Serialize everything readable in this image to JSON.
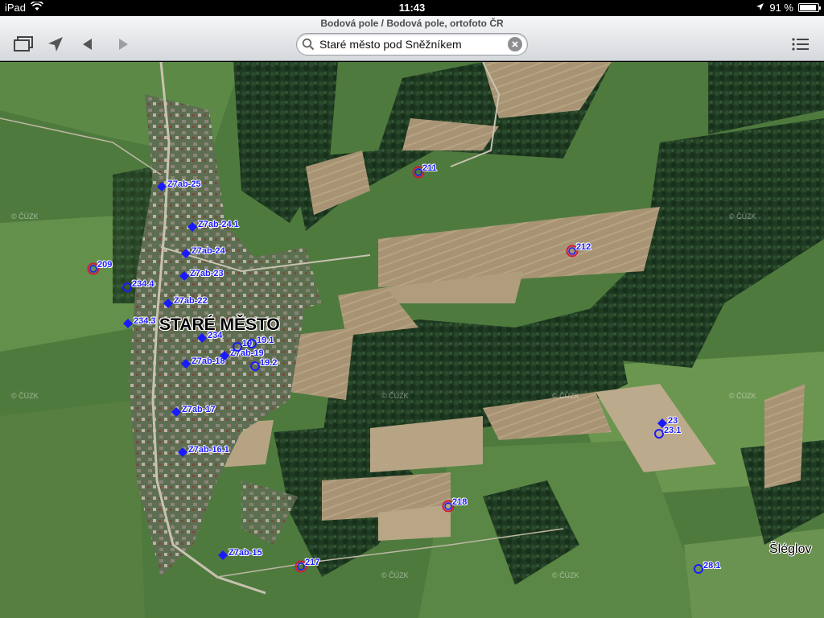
{
  "status": {
    "device": "iPad",
    "time": "11:43",
    "battery": "91 %",
    "battery_level": 0.91
  },
  "toolbar": {
    "title": "Bodová pole  / Bodová pole, ortofoto ČR",
    "search_value": "Staré město pod Sněžníkem"
  },
  "map": {
    "town": "STARÉ MĚSTO",
    "village": "Šléglov",
    "watermark": "© ČÚZK",
    "markers": [
      {
        "label": "Z7ab-25",
        "kind": "blue"
      },
      {
        "label": "Z7ab-24.1",
        "kind": "blue"
      },
      {
        "label": "Z7ab-24",
        "kind": "blue"
      },
      {
        "label": "Z7ab-23",
        "kind": "blue"
      },
      {
        "label": "Z7ab-22",
        "kind": "blue"
      },
      {
        "label": "Z7ab-18",
        "kind": "blue"
      },
      {
        "label": "Z7ab-19",
        "kind": "blue"
      },
      {
        "label": "Z7ab-17",
        "kind": "blue"
      },
      {
        "label": "Z7ab-16.1",
        "kind": "blue"
      },
      {
        "label": "Z7ab-15",
        "kind": "blue"
      },
      {
        "label": "209",
        "kind": "redring"
      },
      {
        "label": "234.4",
        "kind": "bluering"
      },
      {
        "label": "234.3",
        "kind": "blue"
      },
      {
        "label": "234",
        "kind": "blue"
      },
      {
        "label": "19",
        "kind": "bluering"
      },
      {
        "label": "19.1",
        "kind": "bluering"
      },
      {
        "label": "19.2",
        "kind": "bluering"
      },
      {
        "label": "211",
        "kind": "redring"
      },
      {
        "label": "212",
        "kind": "redring"
      },
      {
        "label": "23",
        "kind": "blue"
      },
      {
        "label": "23.1",
        "kind": "bluering"
      },
      {
        "label": "218",
        "kind": "redring"
      },
      {
        "label": "217",
        "kind": "redring"
      },
      {
        "label": "28.1",
        "kind": "bluering"
      },
      {
        "label": "Z7ab-24",
        "kind": "faded"
      }
    ]
  }
}
